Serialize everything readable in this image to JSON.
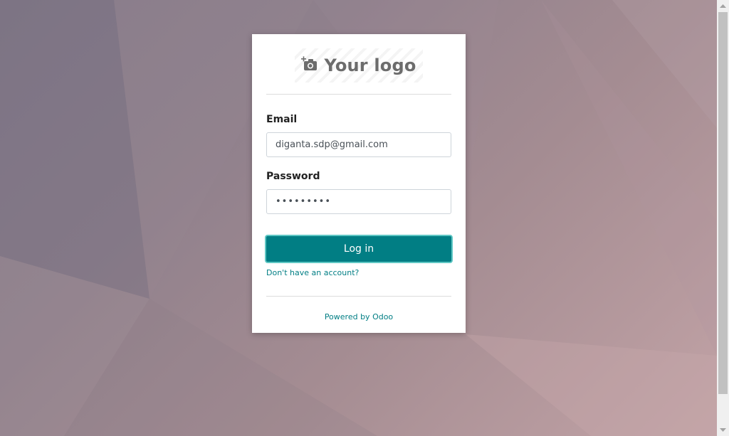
{
  "logo": {
    "text": "Your logo",
    "icon": "camera-plus-icon"
  },
  "form": {
    "email_label": "Email",
    "email_value": "diganta.sdp@gmail.com",
    "password_label": "Password",
    "password_mask": "•••••••••",
    "login_label": "Log in",
    "signup_link": "Don't have an account?"
  },
  "footer": {
    "powered_by": "Powered by Odoo"
  },
  "colors": {
    "primary": "#017e84",
    "focus_ring": "#5fc7c4",
    "background_start": "#847a88",
    "background_end": "#c2a3a6"
  }
}
